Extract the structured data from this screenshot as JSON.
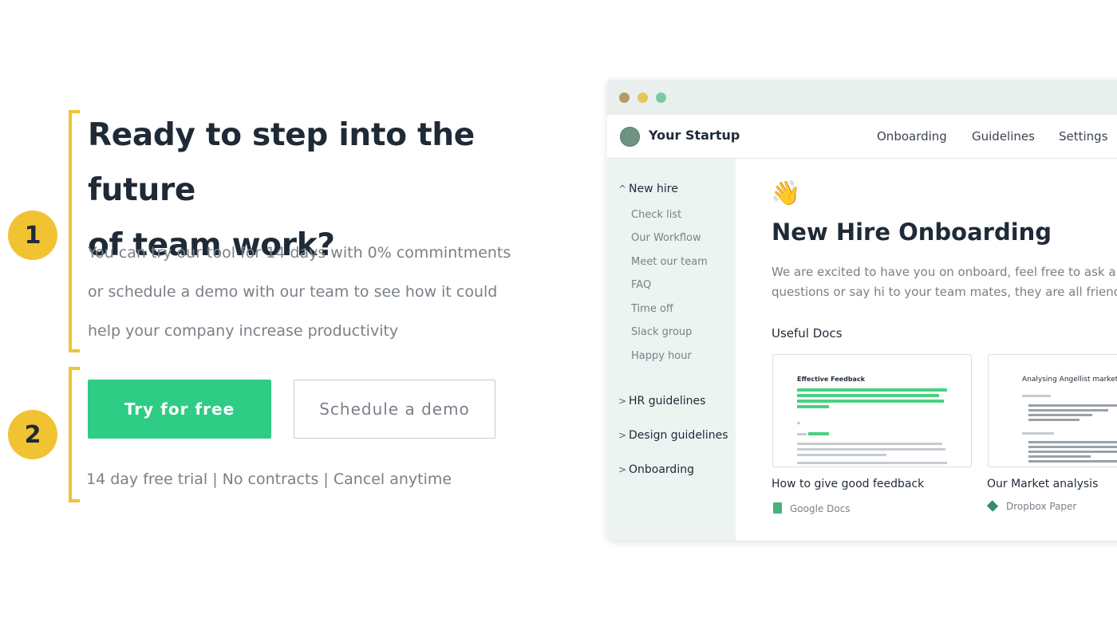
{
  "hero": {
    "title_lines": [
      "Ready to step into the future",
      "of team work?"
    ],
    "subtitle_lines": [
      "You can try our tool for 14 days with 0% commintments",
      "or schedule a demo with our team to see how it could",
      "help your company increase productivity"
    ],
    "primary_button": "Try for free",
    "secondary_button": "Schedule a demo",
    "note": "14 day free trial | No contracts | Cancel anytime",
    "step_badges": [
      "1",
      "2"
    ]
  },
  "app": {
    "name": "Your Startup",
    "nav": [
      "Onboarding",
      "Guidelines",
      "Settings"
    ],
    "sidebar": {
      "new_hire": {
        "chevron": "^",
        "label": "New hire",
        "items": [
          "Check list",
          "Our Workflow",
          "Meet our team",
          "FAQ",
          "Time off",
          "Slack group",
          "Happy hour"
        ]
      },
      "groups": [
        {
          "chevron": ">",
          "label": "HR guidelines"
        },
        {
          "chevron": ">",
          "label": "Design guidelines"
        },
        {
          "chevron": ">",
          "label": "Onboarding"
        }
      ]
    },
    "page": {
      "emoji": "👋",
      "title": "New Hire Onboarding",
      "intro_lines": [
        "We are excited to have you on onboard, feel free to ask any",
        "questions or say hi to your team mates, they are all friendly"
      ],
      "useful_docs_heading": "Useful Docs",
      "docs": [
        {
          "preview_title": "Effective Feedback",
          "title": "How to give good feedback",
          "source": "Google Docs",
          "source_icon": "google-docs-icon"
        },
        {
          "preview_title": "Analysing Angellist markets",
          "title": "Our Market analysis",
          "source": "Dropbox Paper",
          "source_icon": "dropbox-paper-icon"
        }
      ]
    }
  },
  "colors": {
    "accent_yellow": "#f1c232",
    "primary_green": "#2ecc85",
    "text_dark": "#1f2a37",
    "text_muted": "#7a8088",
    "sidebar_bg": "#edf3f1",
    "titlebar_bg": "#e9efed"
  }
}
